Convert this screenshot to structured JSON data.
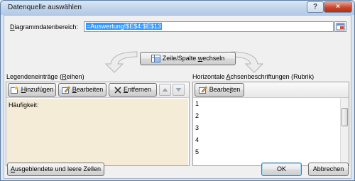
{
  "window": {
    "title": "Datenquelle auswählen",
    "help_icon": "?",
    "close_icon": "×"
  },
  "range": {
    "label_pre": "",
    "label_u": "D",
    "label_post": "iagrammdatenbereich:",
    "value": "=Auswertung!$E$4:$E$13"
  },
  "switch_button": {
    "pre": "Zeile/Spalte ",
    "u": "w",
    "post": "echseln"
  },
  "legend_panel": {
    "title_pre": "Legendeneinträge (",
    "title_u": "R",
    "title_post": "eihen)",
    "add": {
      "u": "H",
      "post": "inzufügen"
    },
    "edit": {
      "u": "B",
      "post": "earbeiten"
    },
    "remove": {
      "u": "E",
      "post": "ntfernen"
    },
    "items": [
      "Häufigkeit:"
    ]
  },
  "axis_panel": {
    "title_pre": "Horizontale ",
    "title_u": "A",
    "title_post": "chsenbeschriftungen (Rubrik)",
    "edit": {
      "pre": "Bearbe",
      "u": "i",
      "post": "ten"
    },
    "items": [
      "1",
      "2",
      "3",
      "4",
      "5"
    ]
  },
  "footer": {
    "hidden_cells": {
      "u": "A",
      "post": "usgeblendete und leere Zellen"
    },
    "ok": "OK",
    "cancel": "Abbrechen"
  },
  "colors": {
    "selection": "#3399ff",
    "selected_row": "#f4ecd6",
    "title_gradient": "#c2d5ec"
  },
  "icons": [
    "help-icon",
    "close-icon",
    "collapse-range-icon",
    "switch-rowcol-icon",
    "add-series-icon",
    "edit-icon",
    "delete-x-icon",
    "move-up-icon",
    "move-down-icon"
  ]
}
